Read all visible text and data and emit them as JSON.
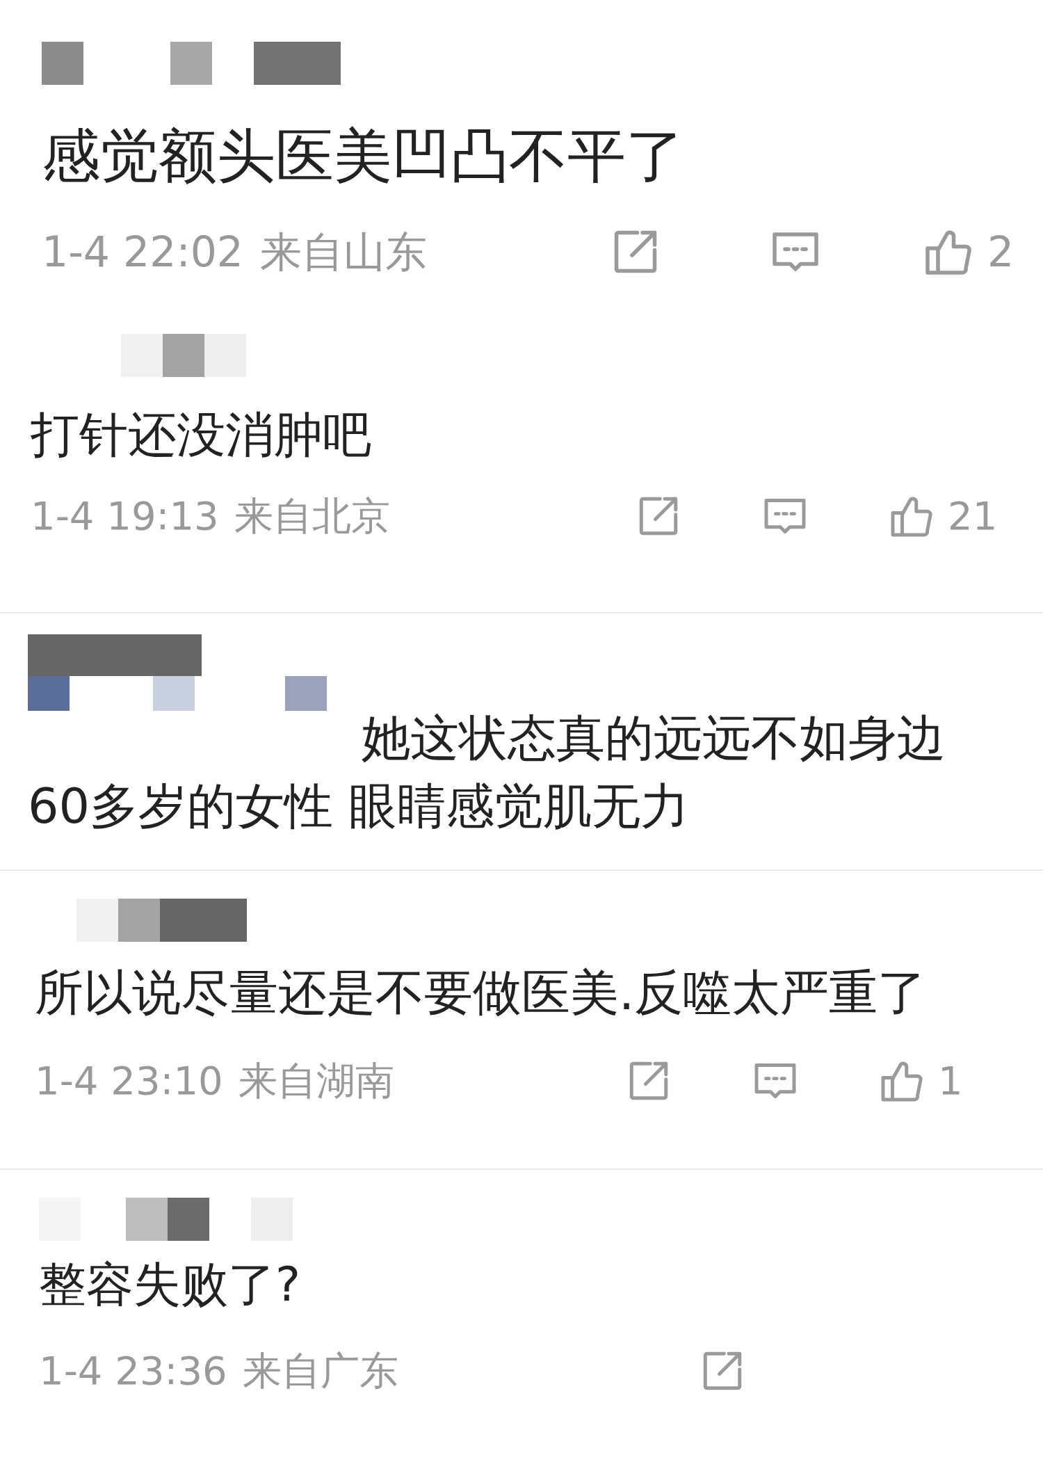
{
  "comments": [
    {
      "text": "感觉额头医美凹凸不平了",
      "time": "1-4 22:02",
      "location": "来自山东",
      "actions": [
        {
          "kind": "share"
        },
        {
          "kind": "comment"
        },
        {
          "kind": "like",
          "count": "2"
        }
      ]
    },
    {
      "text": "打针还没消肿吧",
      "time": "1-4 19:13",
      "location": "来自北京",
      "actions": [
        {
          "kind": "share"
        },
        {
          "kind": "comment"
        },
        {
          "kind": "like",
          "count": "21"
        }
      ]
    },
    {
      "text": "她这状态真的远远不如身边60多岁的女性 眼睛感觉肌无力"
    },
    {
      "text": "所以说尽量还是不要做医美.反噬太严重了",
      "time": "1-4 23:10",
      "location": "来自湖南",
      "actions": [
        {
          "kind": "share"
        },
        {
          "kind": "comment"
        },
        {
          "kind": "like",
          "count": "1"
        }
      ]
    },
    {
      "text": "整容失败了?",
      "time": "1-4 23:36",
      "location": "来自广东",
      "actions": [
        {
          "kind": "share"
        }
      ]
    }
  ]
}
